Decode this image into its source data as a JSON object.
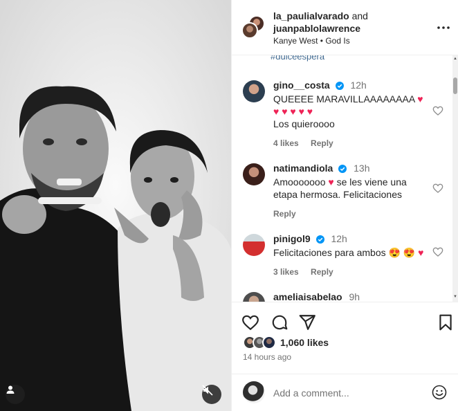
{
  "header": {
    "user1": "la_paulialvarado",
    "and_text": "and",
    "user2": "juanpablolawrence",
    "music": "Kanye West • God Is"
  },
  "hashtag": "#dulceespera",
  "comments": [
    {
      "username": "gino__costa",
      "time": "12h",
      "text_line1": "QUEEEE MARAVILLAAAAAAAA",
      "text_line1_emoji": "♥",
      "hearts": "♥ ♥ ♥ ♥ ♥",
      "text_line3": "Los quieroooo",
      "likes": "4 likes",
      "reply": "Reply"
    },
    {
      "username": "natimandiola",
      "time": "13h",
      "text_a": "Amooooooo",
      "emoji": "♥",
      "text_b": "se les viene una etapa hermosa. Felicitaciones",
      "reply": "Reply"
    },
    {
      "username": "pinigol9",
      "time": "12h",
      "text": "Felicitaciones para ambos",
      "emoji": "😍 😍 ♥",
      "likes": "3 likes",
      "reply": "Reply"
    },
    {
      "username": "ameliaisabelao",
      "time": "9h"
    }
  ],
  "actions": {
    "likes": "1,060 likes",
    "time_ago": "14 hours ago"
  },
  "add_comment": {
    "placeholder": "Add a comment..."
  },
  "colors": {
    "verified": "#0095f6",
    "heart": "#ee2356",
    "muted_text": "#737373",
    "link": "#00376b"
  },
  "icons": [
    "user-tag-icon",
    "mute-icon",
    "more-icon",
    "verified-icon",
    "heart-icon",
    "comment-icon",
    "share-icon",
    "bookmark-icon",
    "emoji-icon"
  ]
}
